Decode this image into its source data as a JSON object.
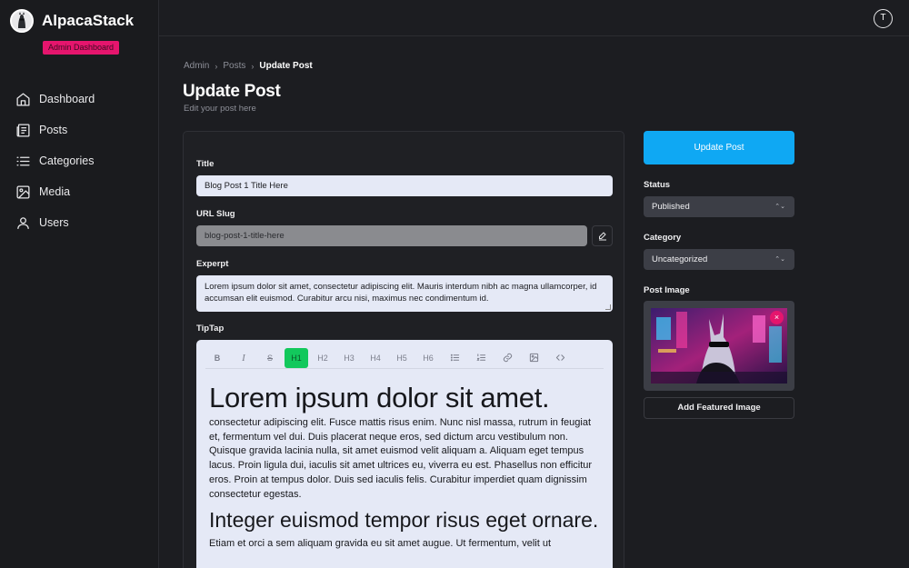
{
  "brand": {
    "name": "AlpacaStack",
    "badge": "Admin Dashboard"
  },
  "sidebar": {
    "items": [
      {
        "label": "Dashboard",
        "icon": "home-icon"
      },
      {
        "label": "Posts",
        "icon": "newspaper-icon"
      },
      {
        "label": "Categories",
        "icon": "list-icon"
      },
      {
        "label": "Media",
        "icon": "image-icon"
      },
      {
        "label": "Users",
        "icon": "user-icon"
      }
    ]
  },
  "topbar": {
    "avatar_initial": "T"
  },
  "breadcrumb": {
    "items": [
      "Admin",
      "Posts"
    ],
    "current": "Update Post"
  },
  "page": {
    "title": "Update Post",
    "subtitle": "Edit your post here"
  },
  "form": {
    "title_label": "Title",
    "title_value": "Blog Post 1 Title Here",
    "slug_label": "URL Slug",
    "slug_value": "blog-post-1-title-here",
    "excerpt_label": "Experpt",
    "excerpt_value": "Lorem ipsum dolor sit amet, consectetur adipiscing elit. Mauris interdum nibh ac magna ullamcorper, id accumsan elit euismod. Curabitur arcu nisi, maximus nec condimentum id.",
    "editor_label": "TipTap"
  },
  "editor": {
    "toolbar": [
      "B",
      "I",
      "S",
      "H1",
      "H2",
      "H3",
      "H4",
      "H5",
      "H6",
      "bullet-list",
      "ordered-list",
      "link",
      "image",
      "code"
    ],
    "active_tool": "H1",
    "heading1": "Lorem ipsum dolor sit amet.",
    "paragraph1": "consectetur adipiscing elit. Fusce mattis risus enim. Nunc nisl massa, rutrum in feugiat et, fermentum vel dui. Duis placerat neque eros, sed dictum arcu vestibulum non. Quisque gravida lacinia nulla, sit amet euismod velit aliquam a. Aliquam eget tempus lacus. Proin ligula dui, iaculis sit amet ultrices eu, viverra eu est. Phasellus non efficitur eros. Proin at tempus dolor. Duis sed iaculis felis. Curabitur imperdiet quam dignissim consectetur egestas.",
    "heading2": "Integer euismod tempor risus eget ornare.",
    "paragraph2": "Etiam et orci a sem aliquam gravida eu sit amet augue. Ut fermentum, velit ut"
  },
  "sidepanel": {
    "update_button": "Update Post",
    "status_label": "Status",
    "status_value": "Published",
    "category_label": "Category",
    "category_value": "Uncategorized",
    "post_image_label": "Post Image",
    "remove_image": "×",
    "add_image_button": "Add Featured Image"
  },
  "colors": {
    "accent_blue": "#0fa8f3",
    "accent_pink": "#e5156d",
    "active_green": "#12c85c",
    "background": "#1c1d21"
  }
}
